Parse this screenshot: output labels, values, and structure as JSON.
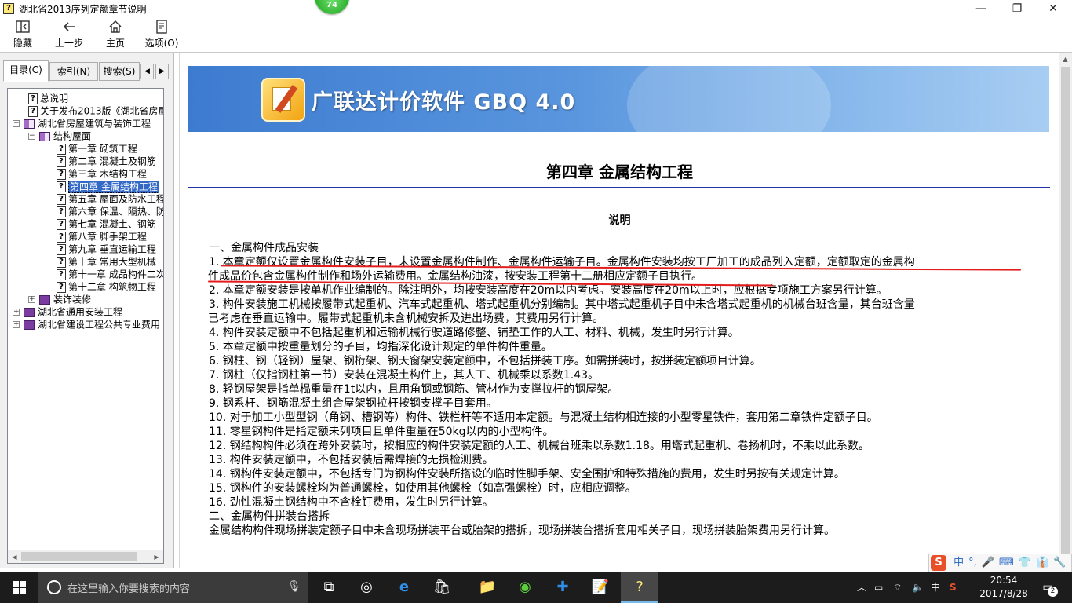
{
  "window": {
    "title": "湖北省2013序列定额章节说明",
    "app_icon": "?",
    "badge": "74",
    "controls": {
      "minimize": "—",
      "maximize": "❐",
      "close": "✕"
    }
  },
  "toolbar": {
    "hide": {
      "label": "隐藏",
      "icon": "hide-icon"
    },
    "back": {
      "label": "上一步",
      "icon": "back-arrow-icon"
    },
    "home": {
      "label": "主页",
      "icon": "home-icon"
    },
    "options": {
      "label": "选项(O)",
      "icon": "options-icon"
    }
  },
  "nav_tabs": {
    "contents": "目录(C)",
    "index": "索引(N)",
    "search": "搜索(S)",
    "prev": "◀",
    "next": "▶"
  },
  "tree": [
    {
      "label": "总说明",
      "icon": "help-page-icon"
    },
    {
      "label": "关于发布2013版《湖北省房屋",
      "icon": "help-page-icon"
    },
    {
      "label": "湖北省房屋建筑与装饰工程",
      "icon": "book-open-icon",
      "expander": "−"
    },
    {
      "label": "结构屋面",
      "icon": "book-open-icon",
      "expander": "−"
    },
    {
      "label": "第一章  砌筑工程",
      "icon": "help-page-icon"
    },
    {
      "label": "第二章  混凝土及钢筋",
      "icon": "help-page-icon"
    },
    {
      "label": "第三章  木结构工程",
      "icon": "help-page-icon"
    },
    {
      "label": "第四章  金属结构工程",
      "icon": "help-page-icon",
      "selected": true
    },
    {
      "label": "第五章  屋面及防水工程",
      "icon": "help-page-icon"
    },
    {
      "label": "第六章  保温、隔热、防",
      "icon": "help-page-icon"
    },
    {
      "label": "第七章  混凝土、钢筋",
      "icon": "help-page-icon"
    },
    {
      "label": "第八章  脚手架工程",
      "icon": "help-page-icon"
    },
    {
      "label": "第九章  垂直运输工程",
      "icon": "help-page-icon"
    },
    {
      "label": "第十章  常用大型机械",
      "icon": "help-page-icon"
    },
    {
      "label": "第十一章  成品构件二次",
      "icon": "help-page-icon"
    },
    {
      "label": "第十二章  构筑物工程",
      "icon": "help-page-icon"
    },
    {
      "label": "装饰装修",
      "icon": "book-closed-icon",
      "expander": "+"
    },
    {
      "label": "湖北省通用安装工程",
      "icon": "book-closed-icon",
      "expander": "+"
    },
    {
      "label": "湖北省建设工程公共专业费用",
      "icon": "book-closed-icon",
      "expander": "+"
    }
  ],
  "banner": {
    "title": "广联达计价软件 GBQ 4.0"
  },
  "document": {
    "chapter_title": "第四章  金属结构工程",
    "section_heading": "说明",
    "lines": [
      "一、金属构件成品安装",
      "1. 本章定额仅设置金属构件安装子目，未设置金属构件制作、金属构件运输子目。金属构件安装均按工厂加工的成品列入定额，定额取定的金属构",
      "件成品价包含金属构件制作和场外运输费用。金属结构油漆，按安装工程第十二册相应定额子目执行。",
      "2. 本章定额安装是按单机作业编制的。除注明外，均按安装高度在20m以内考虑。安装高度在20m以上时，应根据专项施工方案另行计算。",
      "3. 构件安装施工机械按履带式起重机、汽车式起重机、塔式起重机分别编制。其中塔式起重机子目中未含塔式起重机的机械台班含量，其台班含量",
      "已考虑在垂直运输中。履带式起重机未含机械安拆及进出场费，其费用另行计算。",
      "4. 构件安装定额中不包括起重机和运输机械行驶道路修整、铺垫工作的人工、材料、机械，发生时另行计算。",
      "5. 本章定额中按重量划分的子目，均指深化设计规定的单件构件重量。",
      "6. 钢柱、钢（轻钢）屋架、钢桁架、钢天窗架安装定额中，不包括拼装工序。如需拼装时，按拼装定额项目计算。",
      "7. 钢柱（仅指钢柱第一节）安装在混凝土构件上，其人工、机械乘以系数1.43。",
      "8. 轻钢屋架是指单榀重量在1t以内，且用角钢或钢筋、管材作为支撑拉杆的钢屋架。",
      "9. 钢系杆、钢筋混凝土组合屋架钢拉杆按钢支撑子目套用。",
      "10. 对于加工小型型钢（角钢、槽钢等）构件、铁栏杆等不适用本定额。与混凝土结构相连接的小型零星铁件，套用第二章铁件定额子目。",
      "11. 零星钢构件是指定额未列项目且单件重量在50kg以内的小型构件。",
      "12. 钢结构构件必须在跨外安装时，按相应的构件安装定额的人工、机械台班乘以系数1.18。用塔式起重机、卷扬机时，不乘以此系数。",
      "13. 构件安装定额中，不包括安装后需焊接的无损检测费。",
      "14. 钢构件安装定额中，不包括专门为钢构件安装所搭设的临时性脚手架、安全围护和特殊措施的费用，发生时另按有关规定计算。",
      "15. 钢构件的安装螺栓均为普通螺栓，如使用其他螺栓（如高强螺栓）时，应相应调整。",
      "16. 劲性混凝土钢结构中不含栓钉费用，发生时另行计算。",
      "二、金属构件拼装台搭拆",
      "金属结构构件现场拼装定额子目中未含现场拼装平台或胎架的搭拆，现场拼装台搭拆套用相关子目，现场拼装胎架费用另行计算。"
    ]
  },
  "ime": {
    "logo": "S",
    "items": [
      "中",
      "°,",
      "🎤",
      "⌨",
      "👕",
      "👔",
      "🔧"
    ]
  },
  "taskbar": {
    "search_placeholder": "在这里输入你要搜索的内容",
    "tray_text": "中",
    "time": "20:54",
    "date": "2017/8/28",
    "notification_count": "2"
  },
  "colors": {
    "rule": "#2233a8",
    "annotation": "#e41c1c",
    "selection": "#3369c6"
  }
}
